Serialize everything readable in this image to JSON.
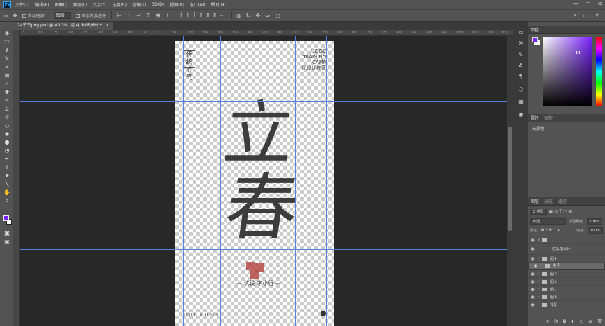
{
  "app": {
    "logo": "Ps"
  },
  "menu": [
    "文件(F)",
    "编辑(E)",
    "图像(I)",
    "图层(L)",
    "文字(Y)",
    "选择(S)",
    "滤镜(T)",
    "3D(D)",
    "视图(V)",
    "窗口(W)",
    "帮助(H)"
  ],
  "window_controls": [
    "—",
    "□",
    "✕"
  ],
  "options": {
    "auto_select_label": "自动选择：",
    "layer_select": "图层",
    "transform_label": "显示变换控件"
  },
  "tab": {
    "title": "24节气png.psd @ 40.3% (组 4, RGB/8*) *",
    "close": "×"
  },
  "ruler_ticks": [
    "5",
    "400",
    "350",
    "300",
    "250",
    "200",
    "150",
    "100",
    "50",
    "0",
    "50",
    "100",
    "150",
    "200",
    "250",
    "300",
    "350",
    "400",
    "450",
    "500",
    "550",
    "600",
    "650",
    "700",
    "750",
    "800",
    "850",
    "900",
    "950",
    "1000",
    "1050",
    "1100",
    "1150"
  ],
  "document": {
    "stamp": "传统\n节气",
    "brand_lines": [
      "UISDC",
      "TRAINING",
      "CAMP"
    ],
    "brand_cn": "优设训练营",
    "big_char_1": "立",
    "big_char_2": "春",
    "author": "— 优设·字小行 —",
    "footer": "UIDJD × UISDC"
  },
  "panels": {
    "color_title": "颜色",
    "props_tabs": [
      "属性",
      "调整"
    ],
    "props_empty": "无属性",
    "layers_tabs": [
      "图层",
      "通道",
      "路径"
    ],
    "kind_label": "Q 类型",
    "blend_mode": "穿透",
    "opacity_label": "不透明度:",
    "opacity_value": "100%",
    "lock_label": "锁定:",
    "fill_label": "填充:",
    "fill_value": "100%"
  },
  "layers": [
    {
      "name": "",
      "type": "group-open",
      "selected": false
    },
    {
      "name": "优设·字小行",
      "type": "text",
      "selected": false
    },
    {
      "name": "组 5",
      "type": "group",
      "selected": false
    },
    {
      "name": "组 4",
      "type": "group",
      "selected": true
    },
    {
      "name": "组 3",
      "type": "group",
      "selected": false
    },
    {
      "name": "组 2",
      "type": "group",
      "selected": false
    },
    {
      "name": "组 7",
      "type": "group",
      "selected": false
    },
    {
      "name": "组 6",
      "type": "group",
      "selected": false
    },
    {
      "name": "背景",
      "type": "group",
      "selected": false
    }
  ],
  "colors": {
    "foreground": "#7a22ff",
    "background": "#ffffff",
    "guide": "#5b7fe0"
  }
}
